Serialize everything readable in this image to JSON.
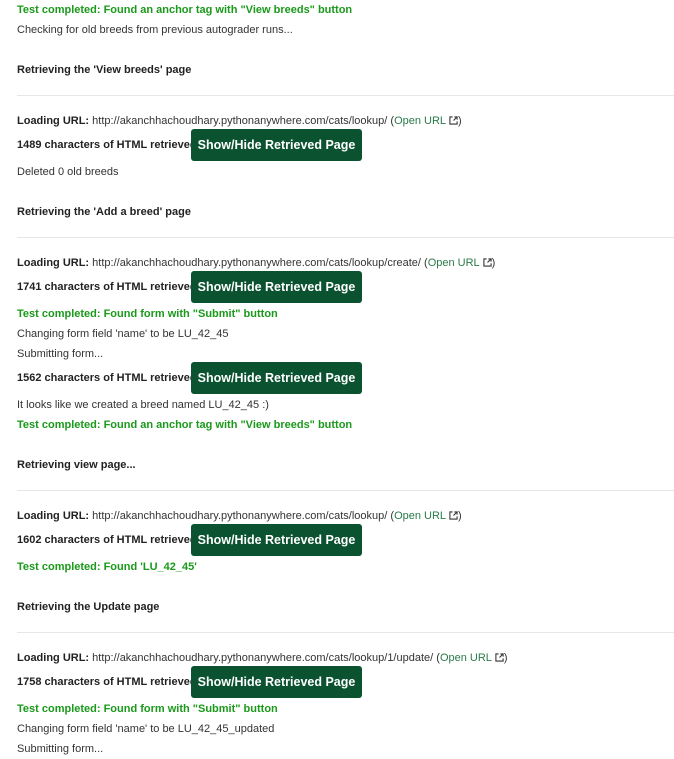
{
  "lines": {
    "l1": "Test completed: Found an anchor tag with \"View breeds\" button",
    "l2": "Checking for old breeds from previous autograder runs...",
    "h1": "Retrieving the 'View breeds' page",
    "url1_label": "Loading URL:",
    "url1": "http://akanchhachoudhary.pythonanywhere.com/cats/lookup/",
    "chars1": "1489 characters of HTML retrieved",
    "l3": "Deleted 0 old breeds",
    "h2": "Retrieving the 'Add a breed' page",
    "url2_label": "Loading URL:",
    "url2": "http://akanchhachoudhary.pythonanywhere.com/cats/lookup/create/",
    "chars2": "1741 characters of HTML retrieved",
    "l4": "Test completed: Found form with \"Submit\" button",
    "l5": "Changing form field 'name' to be LU_42_45",
    "l6": "Submitting form...",
    "chars3": "1562 characters of HTML retrieved",
    "l7": "It looks like we created a breed named LU_42_45 :)",
    "l8": "Test completed: Found an anchor tag with \"View breeds\" button",
    "h3": "Retrieving view page...",
    "url3_label": "Loading URL:",
    "url3": "http://akanchhachoudhary.pythonanywhere.com/cats/lookup/",
    "chars4": "1602 characters of HTML retrieved",
    "l9": "Test completed: Found 'LU_42_45'",
    "h4": "Retrieving the Update page",
    "url4_label": "Loading URL:",
    "url4": "http://akanchhachoudhary.pythonanywhere.com/cats/lookup/1/update/",
    "chars5": "1758 characters of HTML retrieved",
    "l10": "Test completed: Found form with \"Submit\" button",
    "l11": "Changing form field 'name' to be LU_42_45_updated",
    "l12": "Submitting form..."
  },
  "open_url_label": "Open URL",
  "paren_open": "(",
  "paren_close": ")",
  "toggle_button_label": "Show/Hide Retrieved Page",
  "colors": {
    "success": "#1a9a1a",
    "button_bg": "#0b5230",
    "link": "#2a7a4a"
  }
}
